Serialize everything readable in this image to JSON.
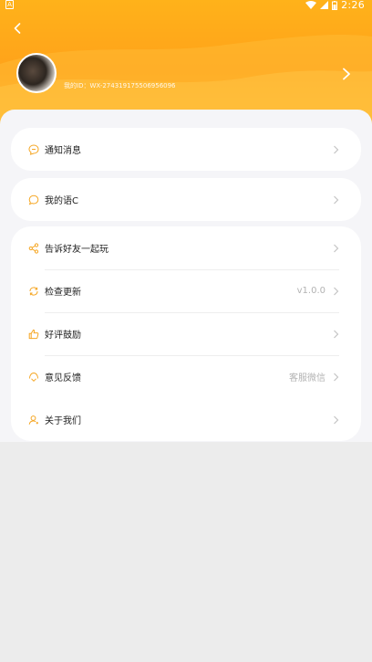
{
  "status_bar": {
    "time": "2:26",
    "left_badge": "A"
  },
  "header": {
    "user_id_text": "我的ID：WX-274319175506956096"
  },
  "menu": {
    "notifications_label": "通知消息",
    "my_yuc_label": "我的语C",
    "share_label": "告诉好友一起玩",
    "check_update_label": "检查更新",
    "check_update_value": "v1.0.0",
    "rate_label": "好评鼓励",
    "feedback_label": "意见反馈",
    "feedback_value": "客服微信",
    "about_label": "关于我们"
  },
  "colors": {
    "accent": "#ffa81a",
    "icon": "#f5a623"
  },
  "icons": [
    "back-icon",
    "chevron-right-icon",
    "message-icon",
    "chat-bubble-icon",
    "share-icon",
    "refresh-icon",
    "thumbs-up-icon",
    "feedback-icon",
    "user-icon"
  ]
}
